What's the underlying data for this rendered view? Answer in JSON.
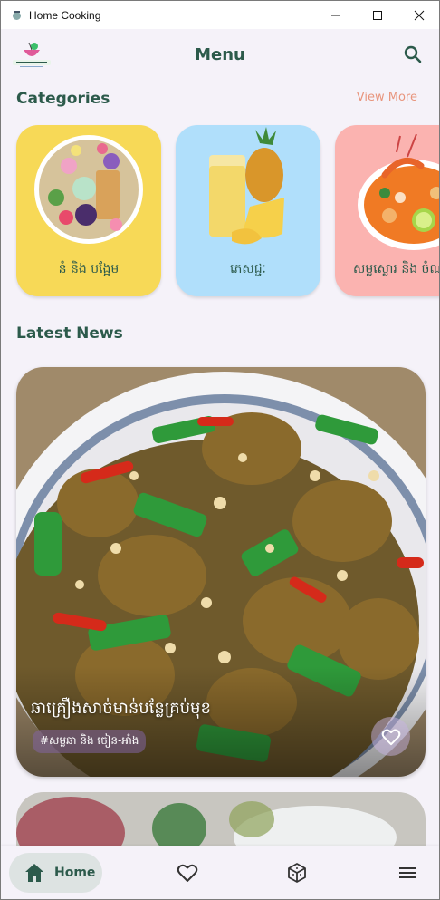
{
  "window": {
    "title": "Home Cooking"
  },
  "header": {
    "title": "Menu",
    "logo_text": "Home Cooking"
  },
  "categories": {
    "title": "Categories",
    "view_more": "View More",
    "items": [
      {
        "label": "នំ និង បង្អែម",
        "bg": "#f7d957"
      },
      {
        "label": "ភេសជ្ជៈ",
        "bg": "#b0dffb"
      },
      {
        "label": "សម្លស្ងោរ និង ចំណ",
        "bg": "#fbb3b0"
      }
    ]
  },
  "news": {
    "title": "Latest News",
    "items": [
      {
        "title": "ឆាគ្រឿងសាច់មាន់បន្លែគ្រប់មុខ",
        "tag": "#សម្លឆា និង ចៀន-អាំង"
      }
    ]
  },
  "nav": {
    "home_label": "Home"
  },
  "colors": {
    "primary": "#2c5a4b",
    "accent": "#e8957d",
    "background": "#f5f2f9"
  }
}
